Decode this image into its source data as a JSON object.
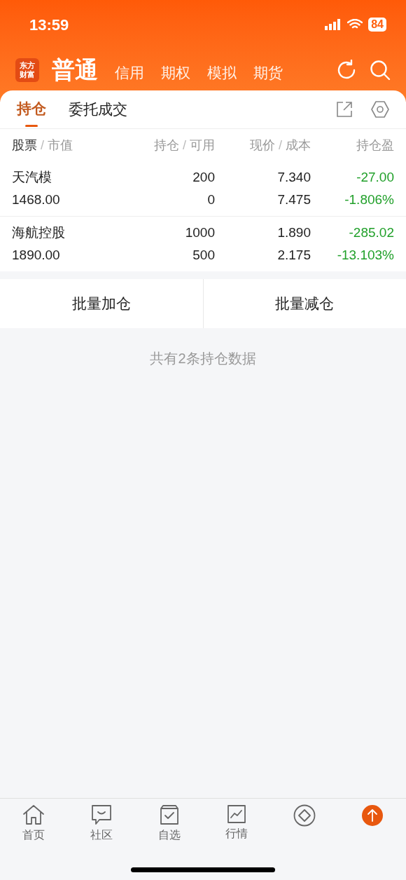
{
  "status_bar": {
    "time": "13:59",
    "battery": "84"
  },
  "header": {
    "logo_lines": [
      "东方",
      "财富"
    ],
    "tabs": [
      {
        "label": "普通",
        "selected": true
      },
      {
        "label": "信用",
        "selected": false
      },
      {
        "label": "期权",
        "selected": false
      },
      {
        "label": "模拟",
        "selected": false
      },
      {
        "label": "期货",
        "selected": false
      }
    ]
  },
  "sub_tabs": [
    {
      "label": "持仓",
      "selected": true
    },
    {
      "label": "委托成交",
      "selected": false
    }
  ],
  "table": {
    "column_separator": "/",
    "columns": [
      [
        "股票",
        "市值"
      ],
      [
        "持仓",
        "可用"
      ],
      [
        "现价",
        "成本"
      ],
      [
        "持仓盈"
      ]
    ],
    "rows": [
      {
        "name": "天汽模",
        "market_value": "1468.00",
        "holding": "200",
        "available": "0",
        "price": "7.340",
        "cost": "7.475",
        "pnl": "-27.00",
        "pnl_pct": "-1.806%"
      },
      {
        "name": "海航控股",
        "market_value": "1890.00",
        "holding": "1000",
        "available": "500",
        "price": "1.890",
        "cost": "2.175",
        "pnl": "-285.02",
        "pnl_pct": "-13.103%"
      }
    ]
  },
  "actions": [
    "批量加仓",
    "批量减仓"
  ],
  "summary": "共有2条持仓数据",
  "bottom_nav": [
    {
      "kind": "home",
      "label": "首页"
    },
    {
      "kind": "chat",
      "label": "社区"
    },
    {
      "kind": "watchlist",
      "label": "自选"
    },
    {
      "kind": "chart",
      "label": "行情"
    },
    {
      "kind": "diamond"
    },
    {
      "kind": "up"
    }
  ]
}
